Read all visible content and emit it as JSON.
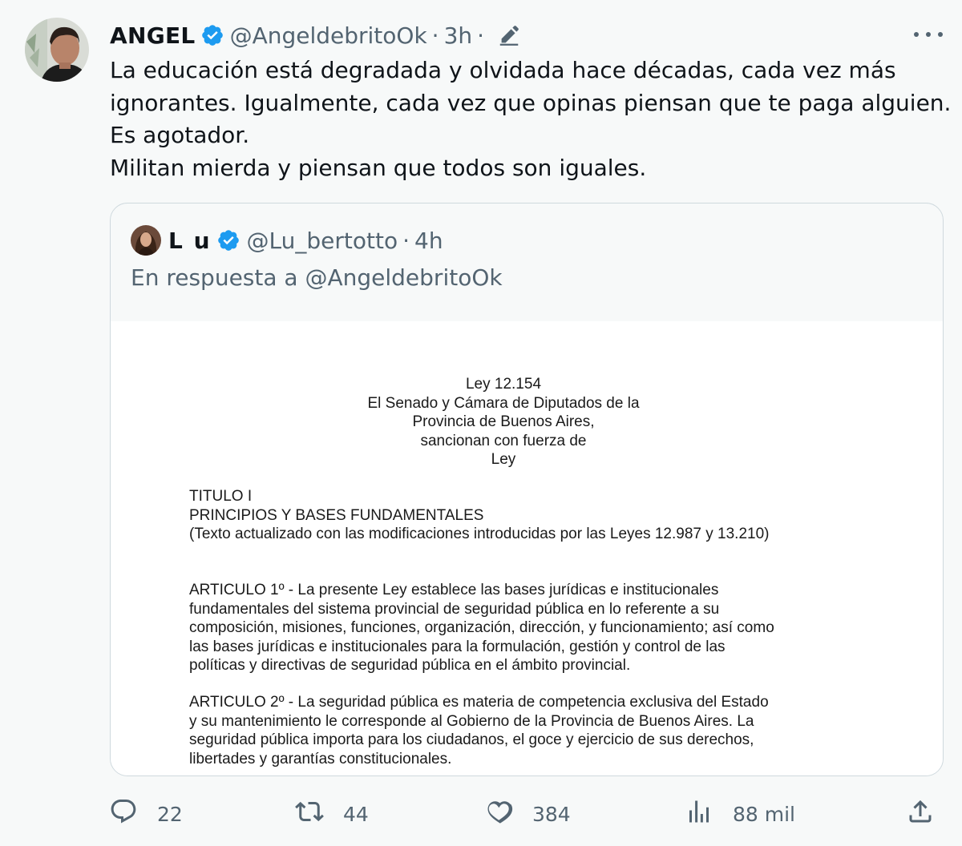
{
  "tweet": {
    "author_name": "ANGEL",
    "author_handle": "@AngeldebritoOk",
    "separator": "·",
    "time": "3h",
    "trailing_separator": "·",
    "text_lines": [
      "La educación está degradada y olvidada hace décadas, cada vez más",
      "ignorantes. Igualmente, cada vez que opinas piensan que te paga alguien.",
      "Es agotador.",
      "Militan mierda y piensan que todos son iguales."
    ],
    "icons": {
      "verified": "verified-badge-icon",
      "edited": "edit-pencil-icon",
      "more": "more-options-icon"
    }
  },
  "quote": {
    "author_name": "L u",
    "author_handle": "@Lu_bertotto",
    "separator": "·",
    "time": "4h",
    "reply_to": "En respuesta a @AngeldebritoOk",
    "document": {
      "heading_lines": [
        "Ley 12.154",
        "El Senado y Cámara de Diputados de la",
        "Provincia de Buenos Aires,",
        "sancionan con fuerza de",
        "Ley"
      ],
      "title_lines": [
        "TITULO I",
        "PRINCIPIOS Y BASES FUNDAMENTALES",
        "(Texto actualizado con las modificaciones introducidas por las Leyes 12.987 y 13.210)"
      ],
      "article1_lines": [
        "ARTICULO 1º - La presente Ley establece las bases jurídicas e institucionales",
        "fundamentales del sistema provincial de seguridad pública en lo referente a su",
        "composición, misiones, funciones, organización, dirección, y funcionamiento; así como",
        "las bases jurídicas e institucionales para la formulación, gestión y control de las",
        "políticas y directivas de seguridad pública en el ámbito provincial."
      ],
      "article2_lines": [
        "ARTICULO 2º - La seguridad pública es materia de competencia exclusiva del Estado",
        "y su mantenimiento le corresponde al Gobierno de la Provincia de Buenos Aires. La",
        "seguridad pública importa para los ciudadanos, el goce y ejercicio de sus derechos,",
        "libertades y garantías constitucionales."
      ]
    }
  },
  "actions": {
    "reply_count": "22",
    "retweet_count": "44",
    "like_count": "384",
    "views_count": "88 mil",
    "icons": [
      "reply-icon",
      "retweet-icon",
      "like-icon",
      "views-icon",
      "share-icon"
    ]
  },
  "colors": {
    "verified_blue": "#1d9bf0",
    "secondary_text": "#536471",
    "background": "#f7f9f9",
    "border": "#cfd9de"
  }
}
